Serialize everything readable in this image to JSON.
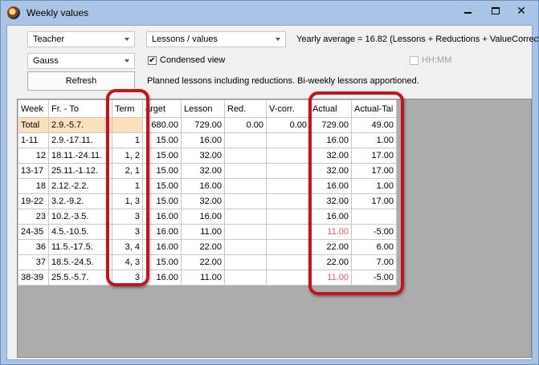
{
  "window": {
    "title": "Weekly values"
  },
  "controls": {
    "type_combo": "Teacher",
    "element_combo": "Gauss",
    "refresh_label": "Refresh",
    "view_combo": "Lessons / values",
    "yearly_average": "Yearly average = 16.82 (Lessons + Reductions + ValueCorrect",
    "condensed_view_label": "Condensed view",
    "condensed_view_checked": true,
    "hhmm_label": "HH:MM",
    "hhmm_checked": false,
    "info_text": "Planned lessons including reductions. Bi-weekly lessons apportioned."
  },
  "table": {
    "columns": [
      "Week",
      "Fr. - To",
      "Term",
      "arget",
      "Lesson",
      "Red.",
      "V-corr.",
      "Actual",
      "Actual-Tai"
    ],
    "total": {
      "week": "Total",
      "range": "2.9.-5.7.",
      "term": "",
      "target": "680.00",
      "lesson": "729.00",
      "red": "0.00",
      "vcorr": "0.00",
      "actual": "729.00",
      "actual_target": "49.00"
    },
    "rows": [
      {
        "week": "1-11",
        "range": "2.9.-17.11.",
        "term": "1",
        "target": "15.00",
        "lesson": "16.00",
        "red": "",
        "vcorr": "",
        "actual": "16.00",
        "actual_red": false,
        "actual_target": "1.00"
      },
      {
        "week": "12",
        "range": "18.11.-24.11.",
        "term": "1, 2",
        "target": "15.00",
        "lesson": "32.00",
        "red": "",
        "vcorr": "",
        "actual": "32.00",
        "actual_red": false,
        "actual_target": "17.00"
      },
      {
        "week": "13-17",
        "range": "25.11.-1.12.",
        "term": "2, 1",
        "target": "15.00",
        "lesson": "32.00",
        "red": "",
        "vcorr": "",
        "actual": "32.00",
        "actual_red": false,
        "actual_target": "17.00"
      },
      {
        "week": "18",
        "range": "2.12.-2.2.",
        "term": "1",
        "target": "15.00",
        "lesson": "16.00",
        "red": "",
        "vcorr": "",
        "actual": "16.00",
        "actual_red": false,
        "actual_target": "1.00"
      },
      {
        "week": "19-22",
        "range": "3.2.-9.2.",
        "term": "1, 3",
        "target": "15.00",
        "lesson": "32.00",
        "red": "",
        "vcorr": "",
        "actual": "32.00",
        "actual_red": false,
        "actual_target": "17.00"
      },
      {
        "week": "23",
        "range": "10.2.-3.5.",
        "term": "3",
        "target": "16.00",
        "lesson": "16.00",
        "red": "",
        "vcorr": "",
        "actual": "16.00",
        "actual_red": false,
        "actual_target": ""
      },
      {
        "week": "24-35",
        "range": "4.5.-10.5.",
        "term": "3",
        "target": "16.00",
        "lesson": "11.00",
        "red": "",
        "vcorr": "",
        "actual": "11.00",
        "actual_red": true,
        "actual_target": "-5.00"
      },
      {
        "week": "36",
        "range": "11.5.-17.5.",
        "term": "3, 4",
        "target": "16.00",
        "lesson": "22.00",
        "red": "",
        "vcorr": "",
        "actual": "22.00",
        "actual_red": false,
        "actual_target": "6.00"
      },
      {
        "week": "37",
        "range": "18.5.-24.5.",
        "term": "4, 3",
        "target": "15.00",
        "lesson": "22.00",
        "red": "",
        "vcorr": "",
        "actual": "22.00",
        "actual_red": false,
        "actual_target": "7.00"
      },
      {
        "week": "38-39",
        "range": "25.5.-5.7.",
        "term": "3",
        "target": "16.00",
        "lesson": "11.00",
        "red": "",
        "vcorr": "",
        "actual": "11.00",
        "actual_red": true,
        "actual_target": "-5.00"
      }
    ]
  },
  "colors": {
    "highlight": "#c0141f",
    "total_term_bg": "#fbe0bb",
    "negative_actual": "#e06060"
  }
}
